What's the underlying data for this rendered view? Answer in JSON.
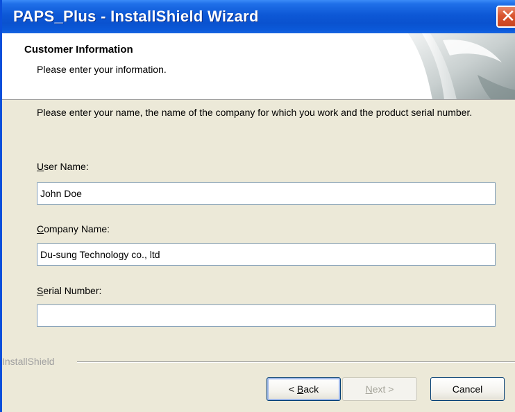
{
  "window": {
    "title": "PAPS_Plus - InstallShield Wizard",
    "close_glyph": "✕"
  },
  "header": {
    "title": "Customer Information",
    "subtitle": "Please enter your information."
  },
  "instructions": "Please enter your name, the name of the company for which you work and the product serial number.",
  "fields": {
    "user_name": {
      "label_mnemonic": "U",
      "label_rest": "ser Name:",
      "value": "John Doe"
    },
    "company_name": {
      "label_mnemonic": "C",
      "label_rest": "ompany Name:",
      "value": "Du-sung Technology co., ltd"
    },
    "serial_number": {
      "label_mnemonic": "S",
      "label_rest": "erial Number:",
      "value": ""
    }
  },
  "brand": "InstallShield",
  "buttons": {
    "back": {
      "prefix": "< ",
      "mnemonic": "B",
      "rest": "ack"
    },
    "next": {
      "mnemonic": "N",
      "rest": "ext >"
    },
    "cancel": {
      "label": "Cancel"
    }
  },
  "colors": {
    "titlebar": "#0A52CF",
    "close": "#D9542F",
    "dialog_bg": "#ECE9D8",
    "input_border": "#7F9DB9"
  }
}
